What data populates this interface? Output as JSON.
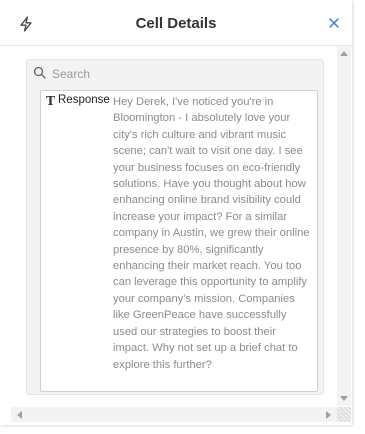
{
  "header": {
    "title": "Cell Details",
    "left_icon": "bolt-icon",
    "close_icon": "close-icon"
  },
  "search": {
    "placeholder": "Search",
    "value": ""
  },
  "field": {
    "type_icon": "T",
    "label": "Response",
    "value": "Hey Derek, I've noticed you're in Bloomington - I absolutely love your city's rich culture and vibrant music scene; can't wait to visit one day. I see your business focuses on eco-friendly solutions. Have you thought about how enhancing online brand visibility could increase your impact? For a similar company in Austin, we grew their online presence by 80%, significantly enhancing their market reach. You too can leverage this opportunity to amplify your company's mission. Companies like GreenPeace have successfully used our strategies to boost their impact. Why not set up a brief chat to explore this further?"
  },
  "colors": {
    "close": "#2a7bd0",
    "value_text": "#8c8c8c",
    "card_bg": "#f3f3f3"
  }
}
